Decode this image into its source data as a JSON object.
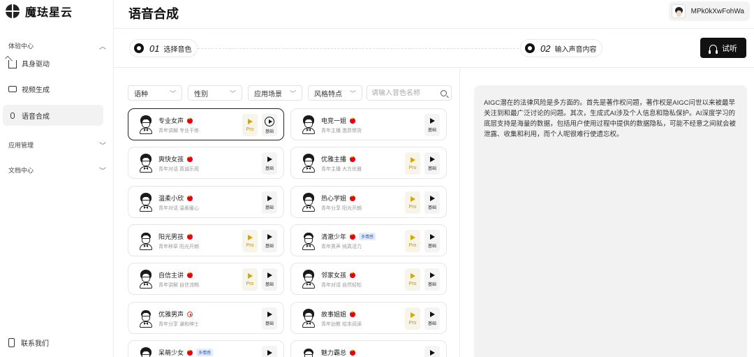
{
  "brand": {
    "name": "魔珐星云"
  },
  "sidebar": {
    "groups": [
      {
        "title": "体验中心",
        "chevron": "up",
        "items": [
          {
            "label": "具身驱动",
            "icon": "home-icon",
            "active": false
          },
          {
            "label": "视频生成",
            "icon": "video-icon",
            "active": false
          },
          {
            "label": "语音合成",
            "icon": "mic-icon",
            "active": true
          }
        ]
      },
      {
        "title": "应用管理",
        "chevron": "down",
        "items": []
      },
      {
        "title": "文档中心",
        "chevron": "down",
        "items": []
      }
    ],
    "contact": "联系我们"
  },
  "header": {
    "title": "语音合成",
    "user": "MPk0kXwFohWa"
  },
  "steps": [
    {
      "num": "01",
      "label": "选择音色"
    },
    {
      "num": "02",
      "label": "输入声音内容"
    }
  ],
  "listen_button": "试听",
  "filters": [
    {
      "label": "语种"
    },
    {
      "label": "性别"
    },
    {
      "label": "应用场景"
    },
    {
      "label": "风格特点"
    }
  ],
  "search": {
    "placeholder": "请输入音色名称"
  },
  "voices": [
    {
      "name": "专业女声",
      "desc": "青年讲解 专业干练",
      "flag": "cn",
      "pro": true,
      "basic_label": "基础",
      "selected": true,
      "gender": "female",
      "multi": ""
    },
    {
      "name": "电竞一姐",
      "desc": "青年主播 激昂带货",
      "flag": "cn",
      "pro": false,
      "basic_label": "基础",
      "selected": false,
      "gender": "female",
      "multi": ""
    },
    {
      "name": "爽快女孩",
      "desc": "青年对话 真诚乐观",
      "flag": "cn",
      "pro": false,
      "basic_label": "基础",
      "selected": false,
      "gender": "female",
      "multi": ""
    },
    {
      "name": "优雅主播",
      "desc": "青年主播 大方优雅",
      "flag": "cn",
      "pro": true,
      "basic_label": "基础",
      "selected": false,
      "gender": "female",
      "multi": ""
    },
    {
      "name": "温柔小欣",
      "desc": "青年对话 温柔暖心",
      "flag": "cn",
      "pro": false,
      "basic_label": "基础",
      "selected": false,
      "gender": "female",
      "multi": ""
    },
    {
      "name": "热心学姐",
      "desc": "青年分享 阳光开朗",
      "flag": "cn",
      "pro": true,
      "basic_label": "基础",
      "selected": false,
      "gender": "female",
      "multi": ""
    },
    {
      "name": "阳光男孩",
      "desc": "青年种草 阳光开朗",
      "flag": "cn",
      "pro": true,
      "basic_label": "基础",
      "selected": false,
      "gender": "male",
      "multi": ""
    },
    {
      "name": "清澈少年",
      "desc": "青年男声 纯真活力",
      "flag": "cn",
      "pro": true,
      "basic_label": "基础",
      "selected": false,
      "gender": "male",
      "multi": "多情感"
    },
    {
      "name": "自信主讲",
      "desc": "青年讲解 自信流畅",
      "flag": "cn",
      "pro": true,
      "basic_label": "基础",
      "selected": false,
      "gender": "female",
      "multi": ""
    },
    {
      "name": "邻家女孩",
      "desc": "青年对话 自然轻松",
      "flag": "cn",
      "pro": true,
      "basic_label": "基础",
      "selected": false,
      "gender": "female",
      "multi": ""
    },
    {
      "name": "优雅男声",
      "desc": "青年分享 谦和绅士",
      "flag": "ca",
      "pro": false,
      "basic_label": "基础",
      "selected": false,
      "gender": "male",
      "multi": ""
    },
    {
      "name": "故事姐姐",
      "desc": "青年幼教 绘本阅读",
      "flag": "cn",
      "pro": true,
      "basic_label": "基础",
      "selected": false,
      "gender": "female",
      "multi": ""
    },
    {
      "name": "呆萌少女",
      "desc": "",
      "flag": "cn",
      "pro": false,
      "basic_label": "基础",
      "selected": false,
      "gender": "female",
      "multi": "多情感"
    },
    {
      "name": "魅力霸总",
      "desc": "",
      "flag": "cn",
      "pro": false,
      "basic_label": "基础",
      "selected": false,
      "gender": "male",
      "multi": ""
    }
  ],
  "pro_label": "Pro",
  "content_text": "AIGC潜在的法律风险是多方面的。首先是著作权问题，著作权是AIGC问世以来被最早关注到和最广泛讨论的问题。其次，生成式AI涉及个人信息和隐私保护。AI深度学习的底层支持是海量的数据，包括用户使用过程中提供的数据隐私，可能不经意之间就会被泄露、收集和利用，而个人呢很难行使遗忘权。"
}
